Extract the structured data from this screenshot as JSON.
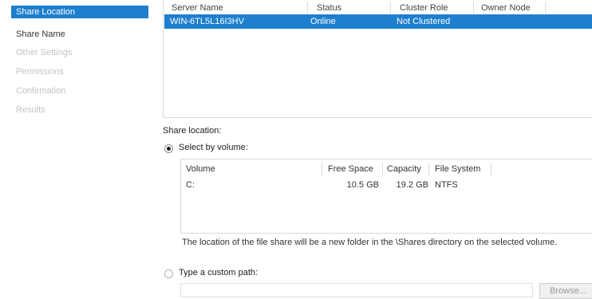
{
  "nav": {
    "items": [
      {
        "label": "Share Location",
        "state": "active"
      },
      {
        "label": "Share Name",
        "state": "normal"
      },
      {
        "label": "Other Settings",
        "state": "disabled"
      },
      {
        "label": "Permissions",
        "state": "disabled"
      },
      {
        "label": "Confirmation",
        "state": "disabled"
      },
      {
        "label": "Results",
        "state": "disabled"
      }
    ]
  },
  "servers": {
    "columns": [
      "Server Name",
      "Status",
      "Cluster Role",
      "Owner Node"
    ],
    "rows": [
      {
        "server_name": "WIN-6TL5L16I3HV",
        "status": "Online",
        "cluster_role": "Not Clustered",
        "owner_node": ""
      }
    ]
  },
  "share_location": {
    "heading": "Share location:",
    "by_volume_label": "Select by volume:",
    "custom_path_label": "Type a custom path:",
    "selected_option": "by_volume"
  },
  "volumes": {
    "columns": [
      "Volume",
      "Free Space",
      "Capacity",
      "File System"
    ],
    "rows": [
      {
        "volume": "C:",
        "free_space": "10.5 GB",
        "capacity": "19.2 GB",
        "file_system": "NTFS"
      }
    ]
  },
  "note": "The location of the file share will be a new folder in the \\Shares directory on the selected volume.",
  "custom_path": {
    "value": ""
  },
  "browse_button": {
    "label": "Browse..."
  },
  "colors": {
    "selection": "#1e7fcf",
    "disabled_text": "#c4c4c4"
  }
}
